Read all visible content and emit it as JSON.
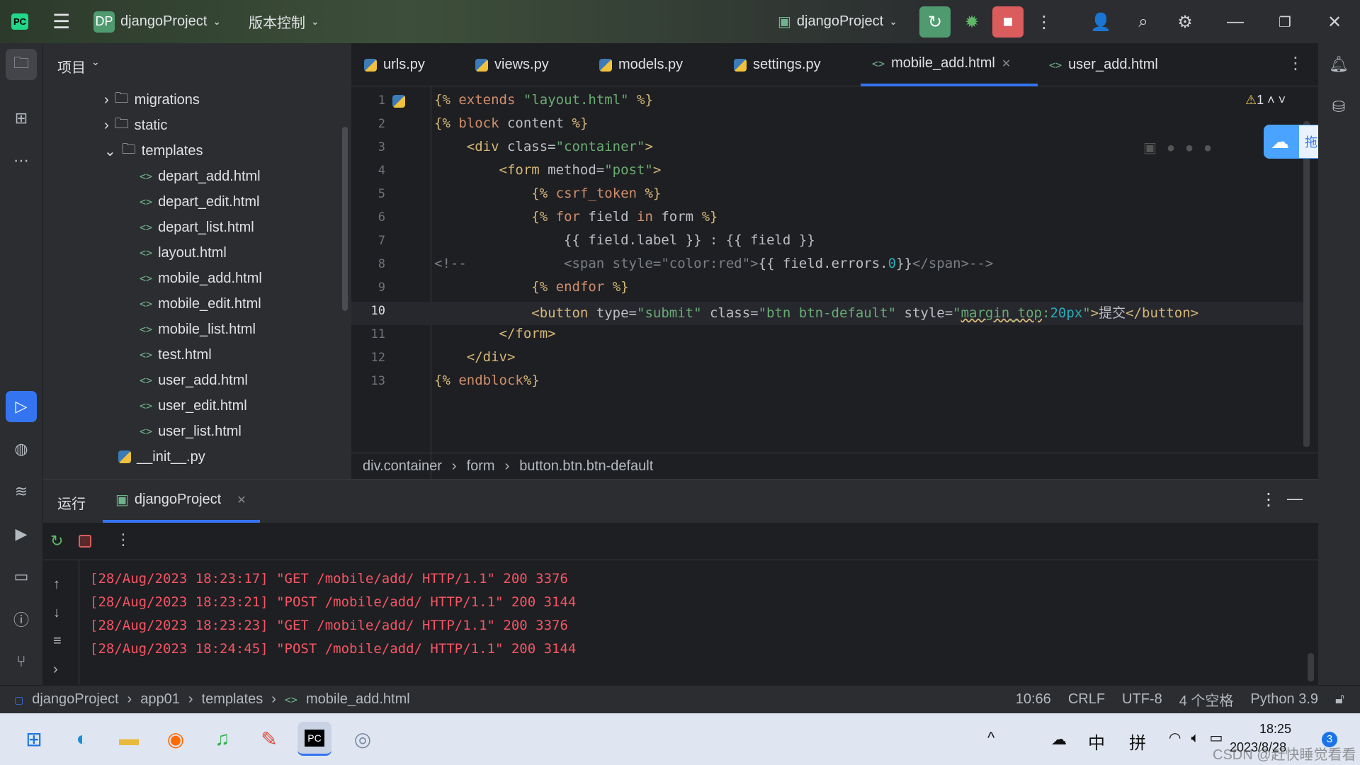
{
  "titlebar": {
    "project": "djangoProject",
    "project_badge": "DP",
    "vcs": "版本控制",
    "run_config": "djangoProject"
  },
  "project_panel": {
    "title": "项目",
    "items": [
      {
        "label": "migrations",
        "type": "folder",
        "collapsed": true
      },
      {
        "label": "static",
        "type": "folder",
        "collapsed": true
      },
      {
        "label": "templates",
        "type": "folder",
        "collapsed": false
      },
      {
        "label": "depart_add.html",
        "type": "html"
      },
      {
        "label": "depart_edit.html",
        "type": "html"
      },
      {
        "label": "depart_list.html",
        "type": "html"
      },
      {
        "label": "layout.html",
        "type": "html"
      },
      {
        "label": "mobile_add.html",
        "type": "html"
      },
      {
        "label": "mobile_edit.html",
        "type": "html"
      },
      {
        "label": "mobile_list.html",
        "type": "html"
      },
      {
        "label": "test.html",
        "type": "html"
      },
      {
        "label": "user_add.html",
        "type": "html"
      },
      {
        "label": "user_edit.html",
        "type": "html"
      },
      {
        "label": "user_list.html",
        "type": "html"
      },
      {
        "label": "__init__.py",
        "type": "py"
      }
    ]
  },
  "tabs": [
    {
      "label": "urls.py",
      "type": "py"
    },
    {
      "label": "views.py",
      "type": "py"
    },
    {
      "label": "models.py",
      "type": "py"
    },
    {
      "label": "settings.py",
      "type": "py"
    },
    {
      "label": "mobile_add.html",
      "type": "html",
      "active": true
    },
    {
      "label": "user_add.html",
      "type": "html"
    }
  ],
  "editor": {
    "warning_count": "1",
    "cursor_line": 10,
    "line_numbers": [
      "1",
      "2",
      "3",
      "4",
      "5",
      "6",
      "7",
      "8",
      "9",
      "10",
      "11",
      "12",
      "13"
    ]
  },
  "breadcrumb": [
    "div.container",
    "form",
    "button.btn.btn-default"
  ],
  "run_panel": {
    "title": "运行",
    "tab": "djangoProject",
    "log": [
      "[28/Aug/2023 18:23:17] \"GET /mobile/add/ HTTP/1.1\" 200 3376",
      "[28/Aug/2023 18:23:21] \"POST /mobile/add/ HTTP/1.1\" 200 3144",
      "[28/Aug/2023 18:23:23] \"GET /mobile/add/ HTTP/1.1\" 200 3376",
      "[28/Aug/2023 18:24:45] \"POST /mobile/add/ HTTP/1.1\" 200 3144"
    ]
  },
  "status": {
    "path": [
      "djangoProject",
      "app01",
      "templates",
      "mobile_add.html"
    ],
    "position": "10:66",
    "line_sep": "CRLF",
    "encoding": "UTF-8",
    "indent": "4 个空格",
    "interpreter": "Python 3.9"
  },
  "taskbar": {
    "ime1": "中",
    "ime2": "拼",
    "time": "18:25",
    "date": "2023/8/28",
    "notifications": "3",
    "watermark": "CSDN @赶快睡觉看看"
  },
  "upload_widget": "拖拽上",
  "colors": {
    "accent": "#3574f0",
    "run": "#4f9a6f",
    "stop": "#db5c5c",
    "log": "#f75464"
  }
}
